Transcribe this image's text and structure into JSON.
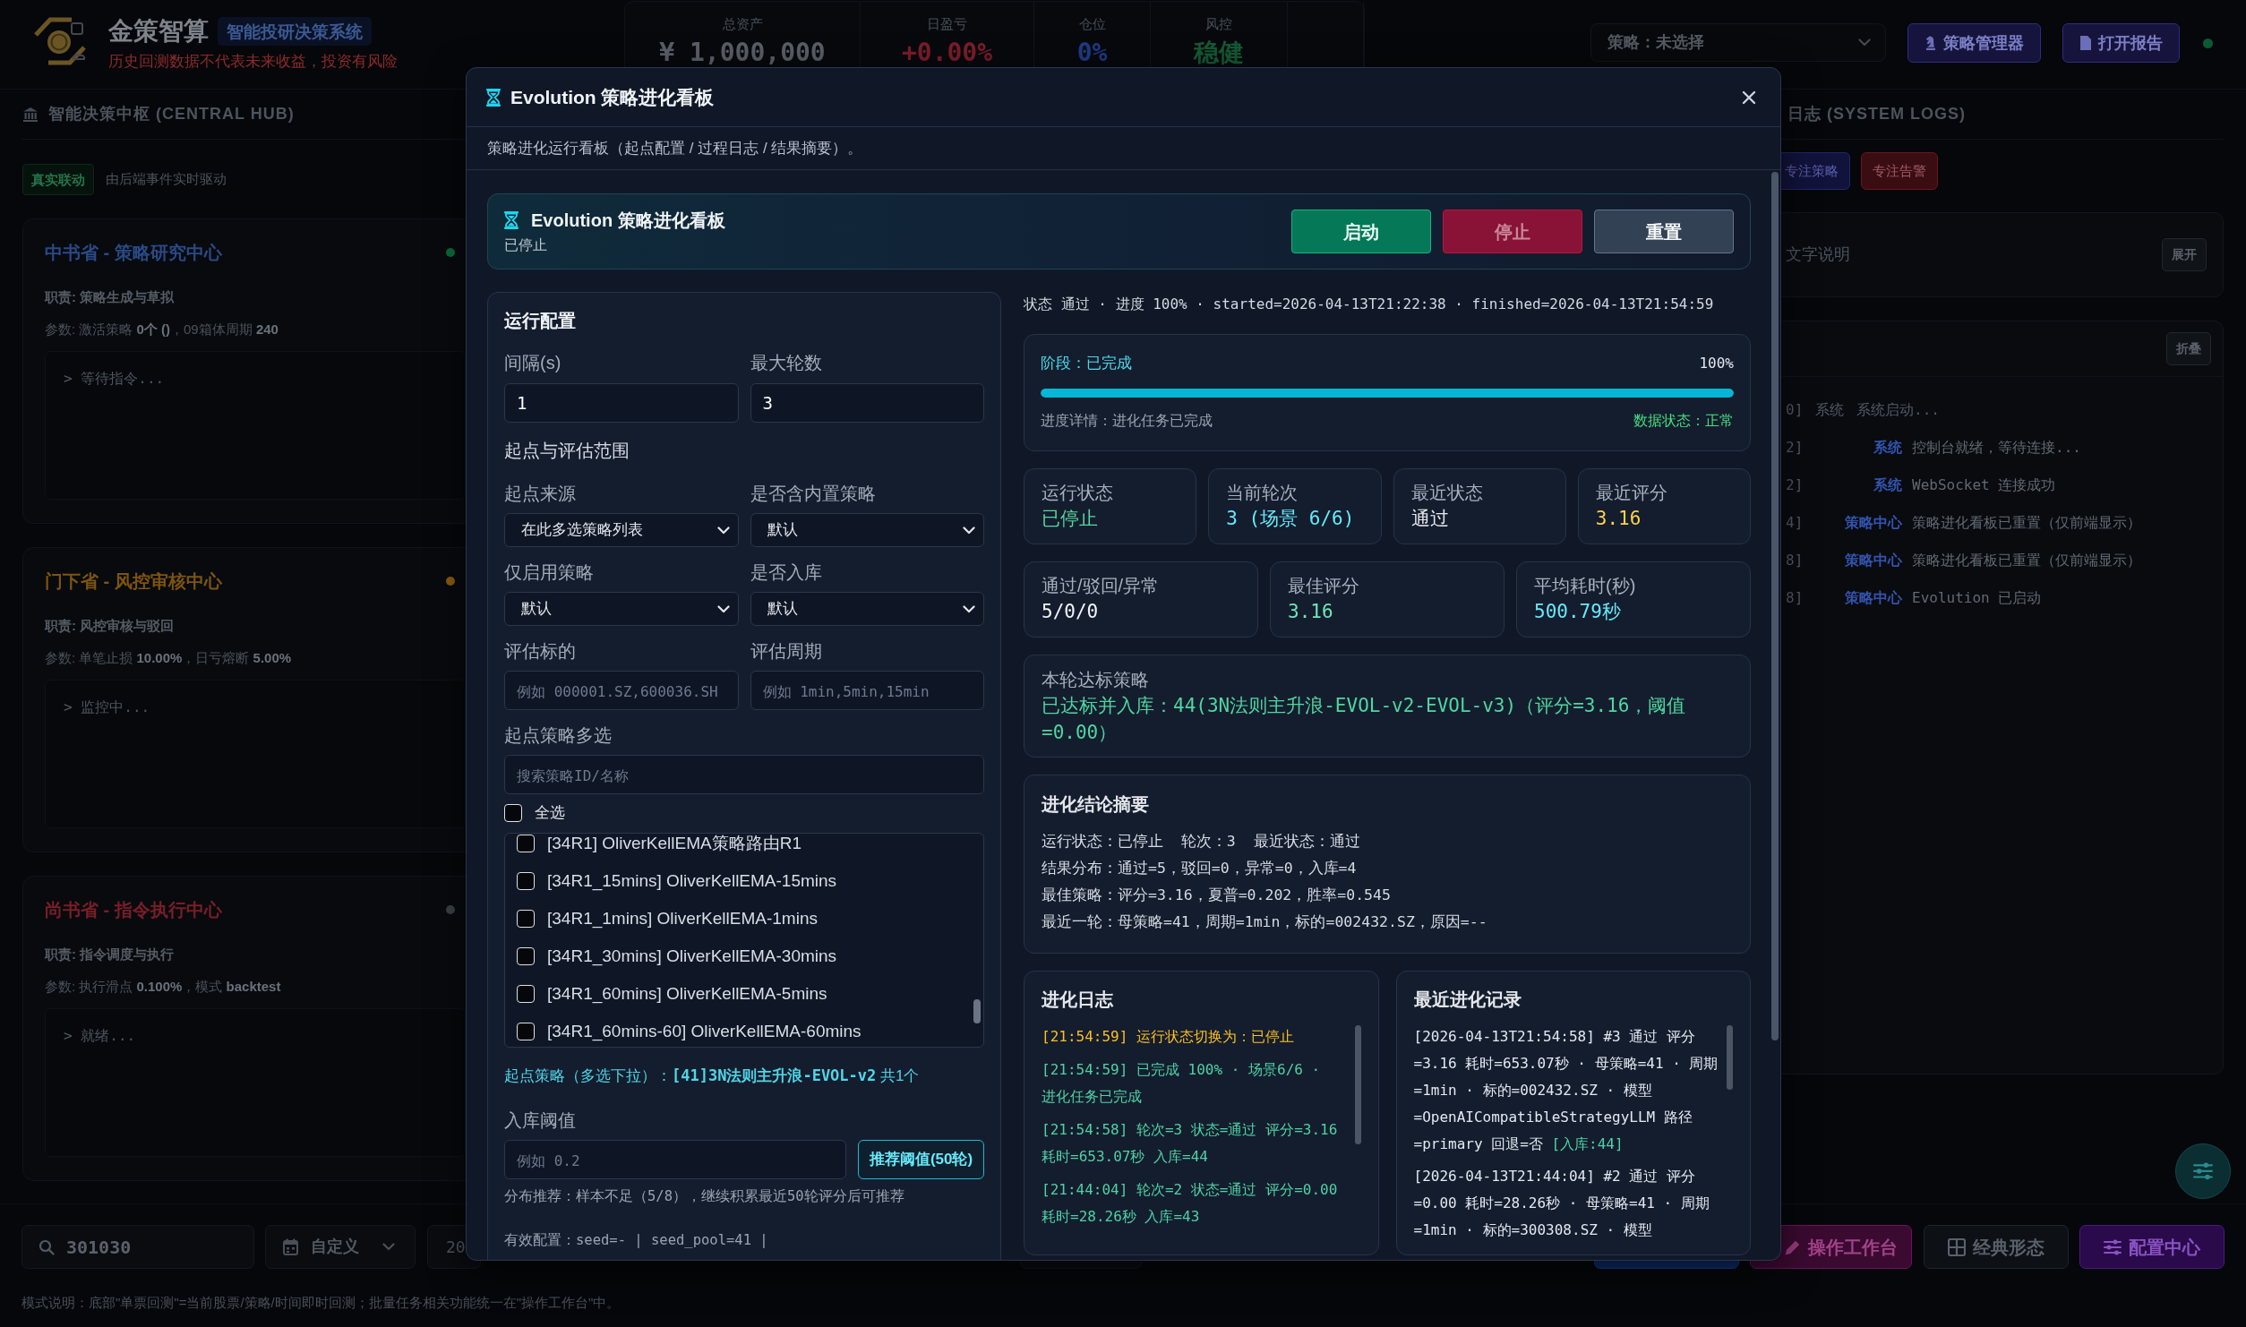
{
  "header": {
    "title": "金策智算",
    "badge": "智能投研决策系统",
    "disclaimer": "历史回测数据不代表未来收益，投资有风险",
    "stats": [
      {
        "label": "总资产",
        "value": "¥ 1,000,000",
        "color": "#5a5f67"
      },
      {
        "label": "日盈亏",
        "value": "+0.00%",
        "color": "#7c1d2a"
      },
      {
        "label": "仓位",
        "value": "0%",
        "color": "#1f3b86"
      },
      {
        "label": "风控",
        "value": "稳健",
        "color": "#145a35"
      }
    ],
    "strategy_select": "策略：未选择",
    "buttons": [
      {
        "label": "策略管理器",
        "kind": "manager"
      },
      {
        "label": "打开报告",
        "kind": "report"
      }
    ],
    "online": true
  },
  "hub": {
    "title": "智能决策中枢 (CENTRAL HUB)",
    "live_tag": "真实联动",
    "note": "由后端事件实时驱动",
    "departments": [
      {
        "title": "中书省 - 策略研究中心",
        "color": "#294a86",
        "dot": {
          "color": "#0c6a3b"
        },
        "duty": "职责: 策略生成与草拟",
        "params": "参数: 激活策略 **0个 ()**，09箱体周期 **240**",
        "terminal": "> 等待指令..."
      },
      {
        "title": "门下省 - 风控审核中心",
        "color": "#7d5410",
        "dot": {
          "color": "#8a5b0c"
        },
        "duty": "职责: 风控审核与驳回",
        "params": "参数: 单笔止损 **10.00%**，日亏熔断 **5.00%**",
        "terminal": "> 监控中..."
      },
      {
        "title": "尚书省 - 指令执行中心",
        "color": "#7a1e28",
        "dot": {
          "color": "#3b4048"
        },
        "duty": "职责: 指令调度与执行",
        "params": "参数: 执行滑点 **0.100%**，模式 **backtest**",
        "terminal": "> 就绪..."
      }
    ]
  },
  "system_logs": {
    "title": "日志 (SYSTEM LOGS)",
    "filters": [
      {
        "label": "专注策略",
        "kind": "strategy"
      },
      {
        "label": "专注告警",
        "kind": "alert"
      }
    ],
    "notes": {
      "title": "文字说明",
      "toggle": "展开"
    },
    "log": {
      "toggle": "折叠",
      "entries": [
        {
          "kind": "boot",
          "stamp": "0]",
          "source": "系统",
          "message": "系统启动..."
        },
        {
          "kind": "entry",
          "stamp": "2]",
          "source": "系统",
          "message": "控制台就绪，等待连接..."
        },
        {
          "kind": "entry",
          "stamp": "2]",
          "source": "系统",
          "message": "WebSocket 连接成功"
        },
        {
          "kind": "entry",
          "stamp": "4]",
          "source": "策略中心",
          "message": "策略进化看板已重置（仅前端显示）"
        },
        {
          "kind": "entry",
          "stamp": "8]",
          "source": "策略中心",
          "message": "策略进化看板已重置（仅前端显示）"
        },
        {
          "kind": "entry",
          "stamp": "8]",
          "source": "策略中心",
          "message": "Evolution 已启动"
        }
      ]
    }
  },
  "bottom_bar": {
    "search": "301030",
    "range": "自定义",
    "date": "20",
    "actions": [
      {
        "kind": "primary"
      },
      {
        "kind": "workbench",
        "label": "操作工作台"
      },
      {
        "kind": "patterns",
        "label": "经典形态"
      },
      {
        "kind": "config",
        "label": "配置中心"
      }
    ]
  },
  "footer_note": "模式说明：底部\"单票回测\"=当前股票/策略/时间即时回测；批量任务相关功能统一在\"操作工作台\"中。",
  "modal": {
    "title": "Evolution 策略进化看板",
    "subtitle": "策略进化运行看板（起点配置 / 过程日志 / 结果摘要）。",
    "hero": {
      "title": "Evolution 策略进化看板",
      "state": "已停止",
      "buttons": [
        {
          "label": "启动",
          "kind": "start",
          "disabled": false
        },
        {
          "label": "停止",
          "kind": "stop",
          "disabled": true
        },
        {
          "label": "重置",
          "kind": "reset",
          "disabled": false
        }
      ]
    },
    "config": {
      "title": "运行配置",
      "fields": [
        {
          "label": "间隔(s)",
          "kind": "input",
          "value": "1"
        },
        {
          "label": "最大轮数",
          "kind": "input",
          "value": "3"
        }
      ],
      "scope": {
        "title": "起点与评估范围",
        "fields": [
          {
            "label": "起点来源",
            "kind": "select",
            "value": "在此多选策略列表"
          },
          {
            "label": "是否含内置策略",
            "kind": "select",
            "value": "默认"
          },
          {
            "label": "仅启用策略",
            "kind": "select",
            "value": "默认"
          },
          {
            "label": "是否入库",
            "kind": "select",
            "value": "默认"
          },
          {
            "label": "评估标的",
            "kind": "input",
            "placeholder": "例如 000001.SZ,600036.SH"
          },
          {
            "label": "评估周期",
            "kind": "input",
            "placeholder": "例如 1min,5min,15min"
          }
        ]
      },
      "multi": {
        "label": "起点策略多选",
        "search_placeholder": "搜索策略ID/名称",
        "select_all": {
          "label": "全选",
          "checked": false
        },
        "options": [
          {
            "label": "[34R1] OliverKellEMA策略路由R1",
            "checked": false
          },
          {
            "label": "[34R1_15mins] OliverKellEMA-15mins",
            "checked": false
          },
          {
            "label": "[34R1_1mins] OliverKellEMA-1mins",
            "checked": false
          },
          {
            "label": "[34R1_30mins] OliverKellEMA-30mins",
            "checked": false
          },
          {
            "label": "[34R1_60mins] OliverKellEMA-5mins",
            "checked": false
          },
          {
            "label": "[34R1_60mins-60] OliverKellEMA-60mins",
            "checked": false
          }
        ],
        "summary": "起点策略（多选下拉）：**[41]3N法则主升浪-EVOL-v2** 共1个"
      },
      "threshold": {
        "label": "入库阈值",
        "placeholder": "例如 0.2",
        "button": "推荐阈值(50轮)",
        "hint": "分布推荐：样本不足（5/8），继续积累最近50轮评分后可推荐"
      },
      "effective": "有效配置：seed=- | seed_pool=41 |"
    },
    "status_line": "状态 通过 · 进度 100% · started=2026-04-13T21:22:38 · finished=2026-04-13T21:54:59",
    "progress": {
      "stage": "阶段：已完成",
      "percent": "100%",
      "level": 1,
      "detail": "进度详情：进化任务已完成",
      "data_state": "数据状态：正常"
    },
    "metric_rows": [
      [
        {
          "label": "运行状态",
          "value": "已停止",
          "color": "#5ad49e"
        },
        {
          "label": "当前轮次",
          "value": "3 (场景 6/6)",
          "color": "#67e8f9"
        },
        {
          "label": "最近状态",
          "value": "通过",
          "color": "#e5e7eb"
        },
        {
          "label": "最近评分",
          "value": "3.16",
          "color": "#fcd34d"
        }
      ],
      [
        {
          "label": "通过/驳回/异常",
          "value": "5/0/0",
          "color": "#f1f5f9"
        },
        {
          "label": "最佳评分",
          "value": "3.16",
          "color": "#6ee7b7"
        },
        {
          "label": "平均耗时(秒)",
          "value": "500.79秒",
          "color": "#67e8f9"
        }
      ]
    ],
    "target": {
      "title": "本轮达标策略",
      "text": "已达标并入库：44(3N法则主升浪-EVOL-v2-EVOL-v3)（评分=3.16，阈值=0.00）"
    },
    "summary": {
      "title": "进化结论摘要",
      "lines": [
        "运行状态：已停止  轮次：3  最近状态：通过",
        "结果分布：通过=5，驳回=0，异常=0，入库=4",
        "最佳策略：评分=3.16，夏普=0.202，胜率=0.545",
        "最近一轮：母策略=41，周期=1min，标的=002432.SZ，原因=--"
      ]
    },
    "log": {
      "title": "进化日志",
      "entries": [
        {
          "text": "[21:54:59] 运行状态切换为：已停止",
          "color": "#fbbf24"
        },
        {
          "text": "[21:54:59] 已完成 100% · 场景6/6 · 进化任务已完成",
          "color": "#4fd1a5"
        },
        {
          "text": "[21:54:58] 轮次=3 状态=通过 评分=3.16 耗时=653.07秒 入库=44",
          "color": "#4fd1a5"
        },
        {
          "text": "[21:44:04] 轮次=2 状态=通过 评分=0.00 耗时=28.26秒 入库=43",
          "color": "#4fd1a5"
        }
      ]
    },
    "records": {
      "title": "最近进化记录",
      "entries": [
        {
          "text": "[2026-04-13T21:54:58] #3 通过 评分=3.16 耗时=653.07秒 · 母策略=41 · 周期=1min · 标的=002432.SZ · 模型=OpenAICompatibleStrategyLLM 路径=primary 回退=否",
          "tag": "[入库:44]"
        },
        {
          "text": "[2026-04-13T21:44:04] #2 通过 评分=0.00 耗时=28.26秒 · 母策略=41 · 周期=1min · 标的=300308.SZ · 模型"
        }
      ]
    }
  }
}
